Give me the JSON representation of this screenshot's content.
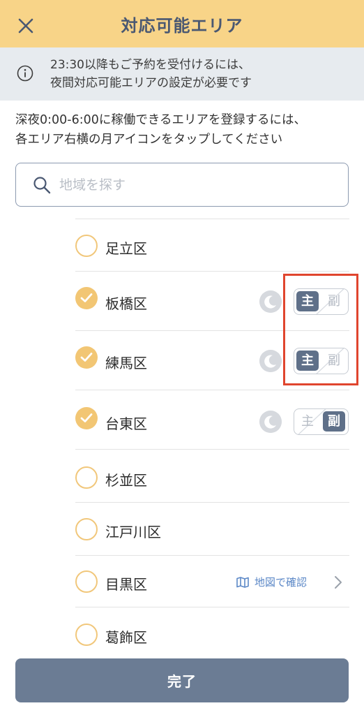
{
  "header": {
    "title": "対応可能エリア",
    "close_icon": "close-icon"
  },
  "notice": {
    "icon": "info-icon",
    "line1": "23:30以降もご予約を受付けるには、",
    "line2": "夜間対応可能エリアの設定が必要です"
  },
  "description": {
    "line1": "深夜0:00-6:00に稼働できるエリアを登録するには、",
    "line2": "各エリア右横の月アイコンをタップしてください"
  },
  "search": {
    "placeholder": "地域を探す",
    "value": "",
    "icon": "search-icon"
  },
  "areas": [
    {
      "label": "足立区",
      "checked": false
    },
    {
      "label": "板橋区",
      "checked": true,
      "moon_icon": "moon-icon",
      "toggle_primary": "主",
      "toggle_secondary": "副",
      "selected": "主"
    },
    {
      "label": "練馬区",
      "checked": true,
      "moon_icon": "moon-icon",
      "toggle_primary": "主",
      "toggle_secondary": "副",
      "selected": "主"
    },
    {
      "label": "台東区",
      "checked": true,
      "moon_icon": "moon-icon",
      "toggle_primary": "主",
      "toggle_secondary": "副",
      "selected": "副"
    },
    {
      "label": "杉並区",
      "checked": false
    },
    {
      "label": "江戸川区",
      "checked": false
    },
    {
      "label": "目黒区",
      "checked": false,
      "map_link": "地図で確認",
      "map_icon": "map-icon",
      "chevron_icon": "chevron-right-icon"
    },
    {
      "label": "葛飾区",
      "checked": false
    }
  ],
  "footer": {
    "done_label": "完了"
  },
  "colors": {
    "header_bg": "#f8d488",
    "title": "#4a5872",
    "notice_bg": "#e7ebef",
    "check": "#f2c674",
    "toggle_active": "#5f7089",
    "link": "#5c88c7",
    "highlight": "#e0452e",
    "done_bg": "#6b7c94"
  }
}
